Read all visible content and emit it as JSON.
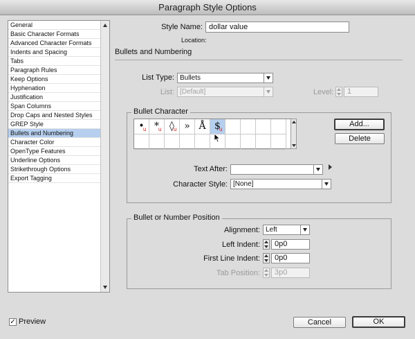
{
  "window": {
    "title": "Paragraph Style Options"
  },
  "sidebar": {
    "items": [
      {
        "label": "General",
        "selected": false
      },
      {
        "label": "Basic Character Formats",
        "selected": false
      },
      {
        "label": "Advanced Character Formats",
        "selected": false
      },
      {
        "label": "Indents and Spacing",
        "selected": false
      },
      {
        "label": "Tabs",
        "selected": false
      },
      {
        "label": "Paragraph Rules",
        "selected": false
      },
      {
        "label": "Keep Options",
        "selected": false
      },
      {
        "label": "Hyphenation",
        "selected": false
      },
      {
        "label": "Justification",
        "selected": false
      },
      {
        "label": "Span Columns",
        "selected": false
      },
      {
        "label": "Drop Caps and Nested Styles",
        "selected": false
      },
      {
        "label": "GREP Style",
        "selected": false
      },
      {
        "label": "Bullets and Numbering",
        "selected": true
      },
      {
        "label": "Character Color",
        "selected": false
      },
      {
        "label": "OpenType Features",
        "selected": false
      },
      {
        "label": "Underline Options",
        "selected": false
      },
      {
        "label": "Strikethrough Options",
        "selected": false
      },
      {
        "label": "Export Tagging",
        "selected": false
      }
    ]
  },
  "header": {
    "style_name_label": "Style Name:",
    "style_name_value": "dollar value",
    "location_label": "Location:",
    "section_title": "Bullets and Numbering"
  },
  "list": {
    "type_label": "List Type:",
    "type_value": "Bullets",
    "list_label": "List:",
    "list_value": "[Default]",
    "level_label": "Level:",
    "level_value": "1"
  },
  "bullet_character": {
    "group_title": "Bullet Character",
    "glyphs": [
      {
        "char": "•",
        "unicode_mark": "u",
        "selected": false
      },
      {
        "char": "*",
        "unicode_mark": "u",
        "selected": false
      },
      {
        "char": "◊",
        "unicode_mark": "u",
        "selected": false
      },
      {
        "char": "»",
        "unicode_mark": "",
        "selected": false
      },
      {
        "char": "Å",
        "unicode_mark": "",
        "selected": false
      },
      {
        "char": "$",
        "unicode_mark": "u",
        "selected": true
      }
    ],
    "add_label": "Add...",
    "delete_label": "Delete",
    "text_after_label": "Text After:",
    "text_after_value": "",
    "char_style_label": "Character Style:",
    "char_style_value": "[None]"
  },
  "position": {
    "group_title": "Bullet or Number Position",
    "alignment_label": "Alignment:",
    "alignment_value": "Left",
    "left_indent_label": "Left Indent:",
    "left_indent_value": "0p0",
    "first_line_label": "First Line Indent:",
    "first_line_value": "0p0",
    "tab_position_label": "Tab Position:",
    "tab_position_value": "3p0"
  },
  "footer": {
    "preview_label": "Preview",
    "preview_checked": true,
    "cancel_label": "Cancel",
    "ok_label": "OK"
  }
}
